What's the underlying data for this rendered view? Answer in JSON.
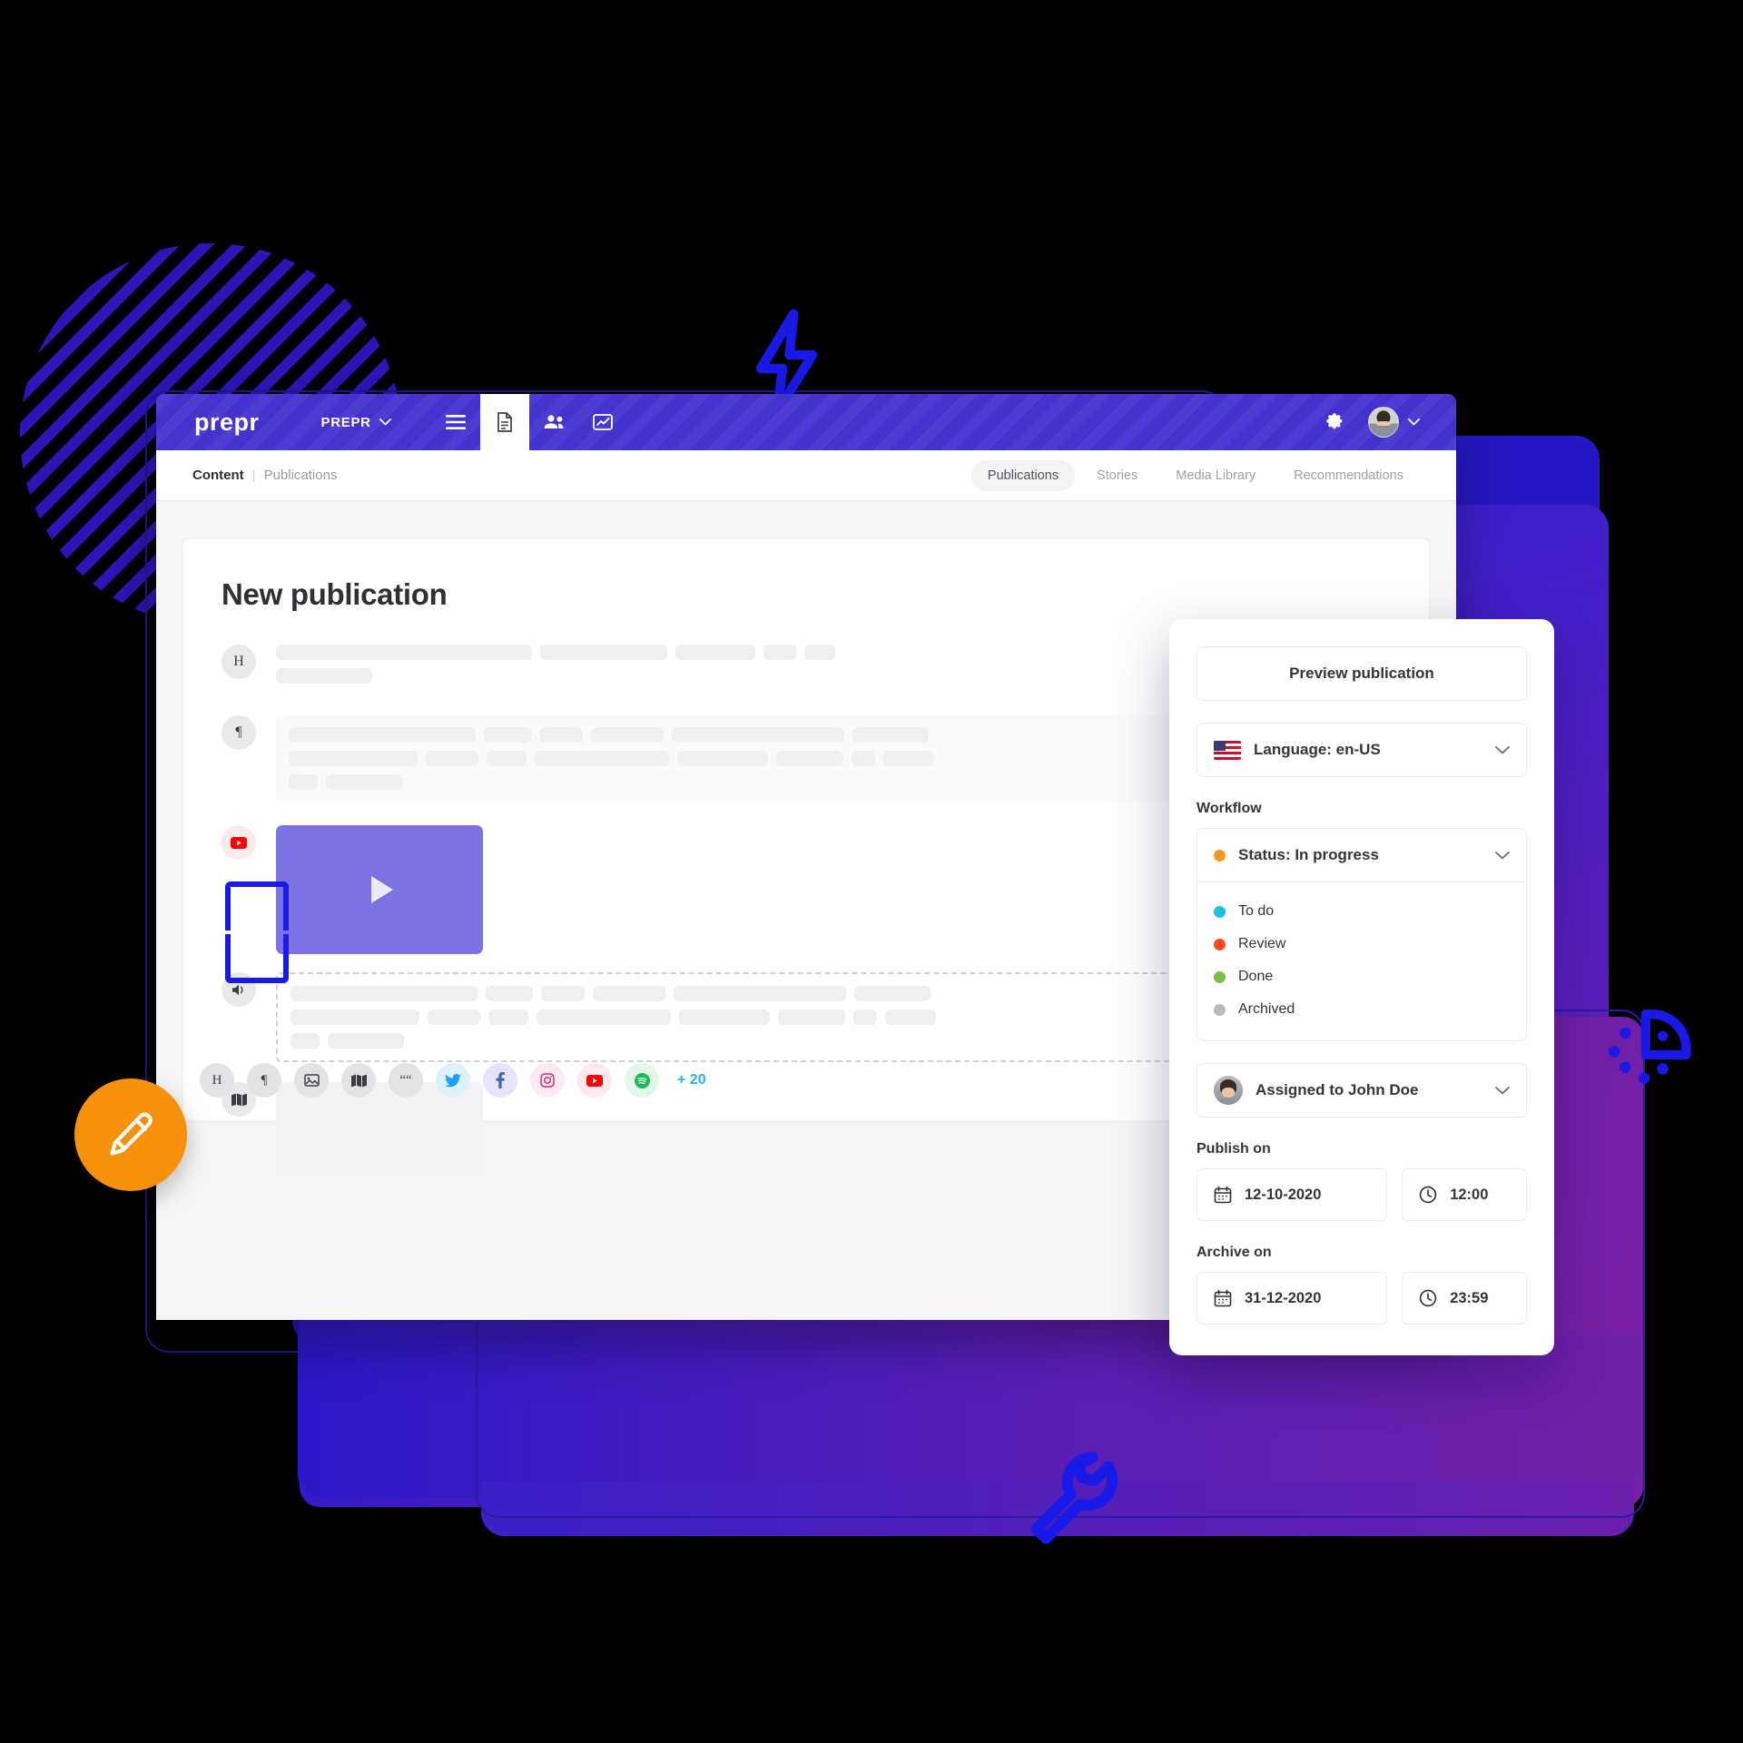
{
  "brand": {
    "logo": "prepr",
    "accent": "#4432cf",
    "orange": "#f6910b",
    "bolt_blue": "#1a1ae8"
  },
  "navbar": {
    "project": "PREPR",
    "icons": [
      {
        "name": "menu-icon",
        "glyph": "hamburger"
      },
      {
        "name": "document-icon",
        "glyph": "document",
        "active": true
      },
      {
        "name": "people-icon",
        "glyph": "people"
      },
      {
        "name": "analytics-icon",
        "glyph": "chart"
      }
    ],
    "settings_icon": "gear-icon",
    "account_chevron": "chevron-down-icon"
  },
  "subbar": {
    "breadcrumb_root": "Content",
    "breadcrumb_sep": "|",
    "breadcrumb_current": "Publications",
    "tabs": [
      {
        "label": "Publications",
        "active": true
      },
      {
        "label": "Stories",
        "active": false
      },
      {
        "label": "Media Library",
        "active": false
      },
      {
        "label": "Recommendations",
        "active": false
      }
    ]
  },
  "editor": {
    "title": "New publication",
    "blocks": [
      {
        "icon": "heading-icon",
        "glyph": "H",
        "type": "heading"
      },
      {
        "icon": "paragraph-icon",
        "glyph": "¶",
        "type": "paragraph"
      },
      {
        "icon": "youtube-icon",
        "glyph": "youtube",
        "type": "video"
      },
      {
        "icon": "audio-icon",
        "glyph": "audio",
        "type": "paragraph-dashed"
      },
      {
        "icon": "map-icon",
        "glyph": "map",
        "type": "image"
      }
    ],
    "toolbar": [
      {
        "name": "heading-icon",
        "glyph": "H",
        "style": ""
      },
      {
        "name": "paragraph-icon",
        "glyph": "¶",
        "style": ""
      },
      {
        "name": "image-icon",
        "glyph": "image",
        "style": ""
      },
      {
        "name": "map-icon",
        "glyph": "map",
        "style": ""
      },
      {
        "name": "quote-icon",
        "glyph": "quote",
        "style": ""
      },
      {
        "name": "twitter-icon",
        "glyph": "twitter",
        "style": "tw"
      },
      {
        "name": "facebook-icon",
        "glyph": "facebook",
        "style": "fb"
      },
      {
        "name": "instagram-icon",
        "glyph": "instagram",
        "style": "ig"
      },
      {
        "name": "youtube-icon",
        "glyph": "youtube",
        "style": "yt"
      },
      {
        "name": "spotify-icon",
        "glyph": "spotify",
        "style": "sp"
      }
    ],
    "toolbar_more": "+ 20"
  },
  "panel": {
    "preview_button": "Preview publication",
    "language": {
      "label": "Language: en-US",
      "flag": "us-flag-icon"
    },
    "workflow_label": "Workflow",
    "status": {
      "label": "Status: In progress",
      "color": "#f59a1e"
    },
    "status_options": [
      {
        "label": "To do",
        "color": "#1ec2da"
      },
      {
        "label": "Review",
        "color": "#fa4a23"
      },
      {
        "label": "Done",
        "color": "#7ac143"
      },
      {
        "label": "Archived",
        "color": "#b9b9be"
      }
    ],
    "assignee": "Assigned to John Doe",
    "publish_label": "Publish on",
    "publish_date": "12-10-2020",
    "publish_time": "12:00",
    "archive_label": "Archive on",
    "archive_date": "31-12-2020",
    "archive_time": "23:59"
  },
  "decor": {
    "pencil": "pencil-icon",
    "bolt": "lightning-bolt-icon",
    "wrench": "wrench-icon",
    "rocket": "rocket-icon"
  }
}
